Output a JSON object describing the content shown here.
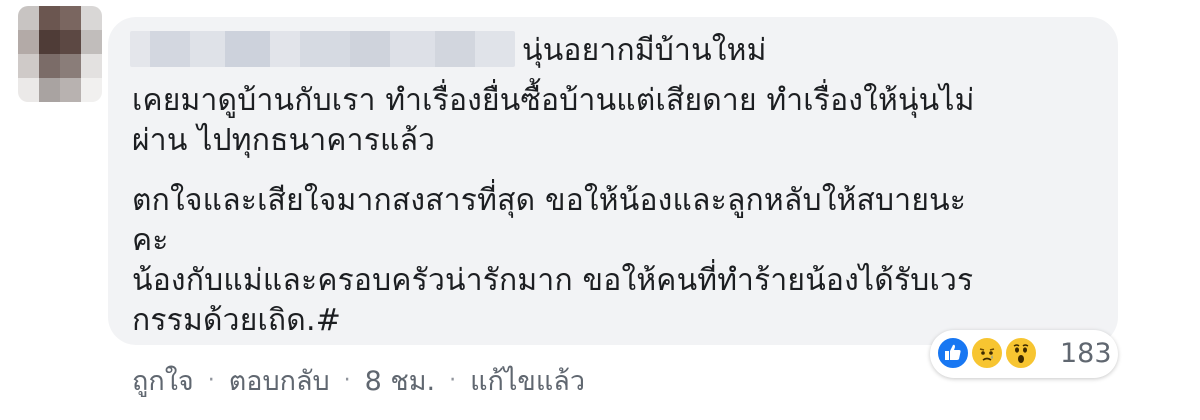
{
  "comment": {
    "author_suffix": "นุ่นอยากมีบ้านใหม่",
    "lines": [
      "เคยมาดูบ้านกับเรา ทำเรื่องยื่นซื้อบ้านแต่เสียดาย ทำเรื่องให้นุ่นไม่",
      "ผ่าน ไปทุกธนาคารแล้ว",
      "ตกใจและเสียใจมากสงสารที่สุด ขอให้น้องและลูกหลับให้สบายนะ",
      "คะ",
      "น้องกับแม่และครอบครัวน่ารักมาก ขอให้คนที่ทำร้ายน้องได้รับเวร",
      "กรรมด้วยเถิด.#"
    ]
  },
  "reactions": {
    "icons": [
      "like-icon",
      "sad-icon",
      "wow-icon"
    ],
    "count": "183",
    "colors": {
      "like": "#1877f2",
      "emoji": "#f7c531"
    }
  },
  "actions": {
    "like": "ถูกใจ",
    "reply": "ตอบกลับ",
    "time": "8 ชม.",
    "edited": "แก้ไขแล้ว",
    "separator": "·"
  },
  "colors": {
    "bubble": "#f2f3f5",
    "text": "#1c1e21",
    "meta": "#606770"
  }
}
